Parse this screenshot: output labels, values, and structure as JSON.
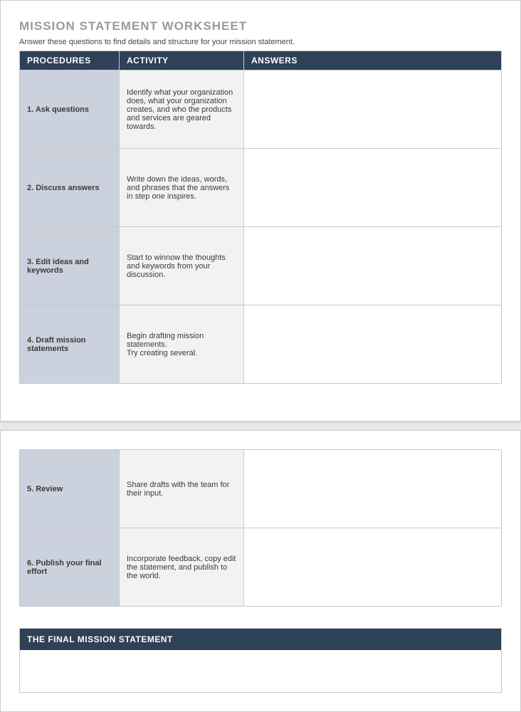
{
  "title": "MISSION STATEMENT WORKSHEET",
  "subtitle": "Answer these questions to find details and structure for your mission statement.",
  "headers": {
    "procedures": "PROCEDURES",
    "activity": "ACTIVITY",
    "answers": "ANSWERS"
  },
  "rows": [
    {
      "procedure": "1. Ask questions",
      "activity": "Identify what your organization does, what your organization creates, and who the products and services are geared towards.",
      "answer": ""
    },
    {
      "procedure": "2. Discuss answers",
      "activity": "Write down the ideas, words, and phrases that the answers in step one inspires.",
      "answer": ""
    },
    {
      "procedure": "3. Edit ideas and keywords",
      "activity": "Start to winnow the thoughts and keywords from your discussion.",
      "answer": ""
    },
    {
      "procedure": "4. Draft mission statements",
      "activity": "Begin drafting mission statements.\nTry creating several.",
      "answer": ""
    },
    {
      "procedure": "5. Review",
      "activity": "Share drafts with the team for their input.",
      "answer": ""
    },
    {
      "procedure": "6. Publish your final effort",
      "activity": "Incorporate feedback, copy edit the statement, and publish to the world.",
      "answer": ""
    }
  ],
  "final_label": "THE FINAL MISSION STATEMENT",
  "final_value": ""
}
